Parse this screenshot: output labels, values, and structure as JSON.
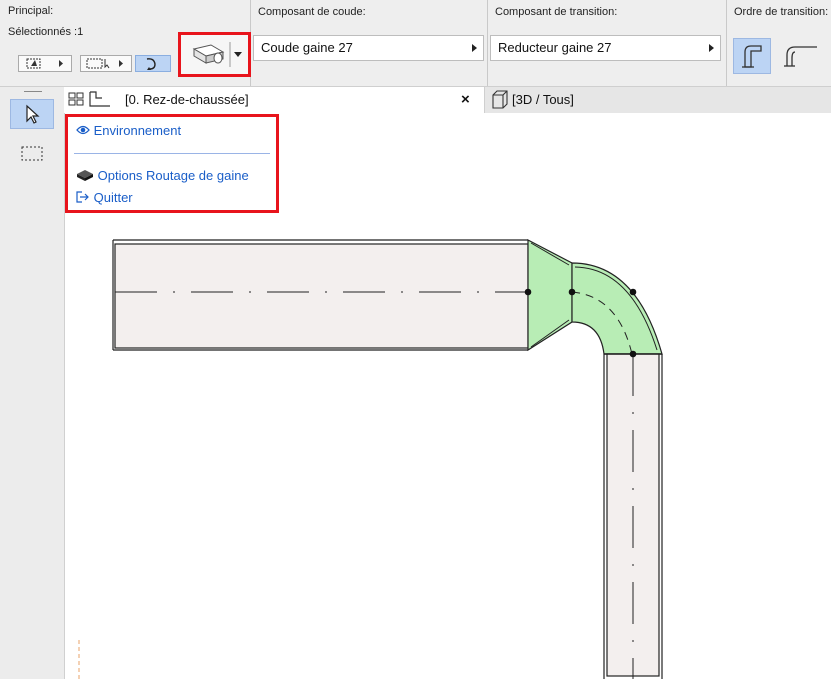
{
  "info_box": {
    "principal_label": "Principal:",
    "selected_label": "Sélectionnés :1",
    "elbow_label": "Composant de coude:",
    "elbow_value": "Coude gaine 27",
    "transition_label": "Composant de transition:",
    "transition_value": "Reducteur gaine 27",
    "order_label": "Ordre de transition:"
  },
  "tabs": [
    {
      "label": "[0. Rez-de-chaussée]",
      "close": "×"
    },
    {
      "label": "[3D / Tous]"
    }
  ],
  "context_menu": {
    "items": [
      {
        "label": "Environnement",
        "icon": "eye-icon"
      },
      {
        "label": "Options Routage de gaine",
        "icon": "duct-routing-icon"
      },
      {
        "label": "Quitter",
        "icon": "exit-icon"
      }
    ]
  },
  "colors": {
    "highlight_red": "#e8141c",
    "menu_text": "#1a5ec8",
    "duct_fill": "#f3efee",
    "transition_fill": "#b8edb5"
  }
}
